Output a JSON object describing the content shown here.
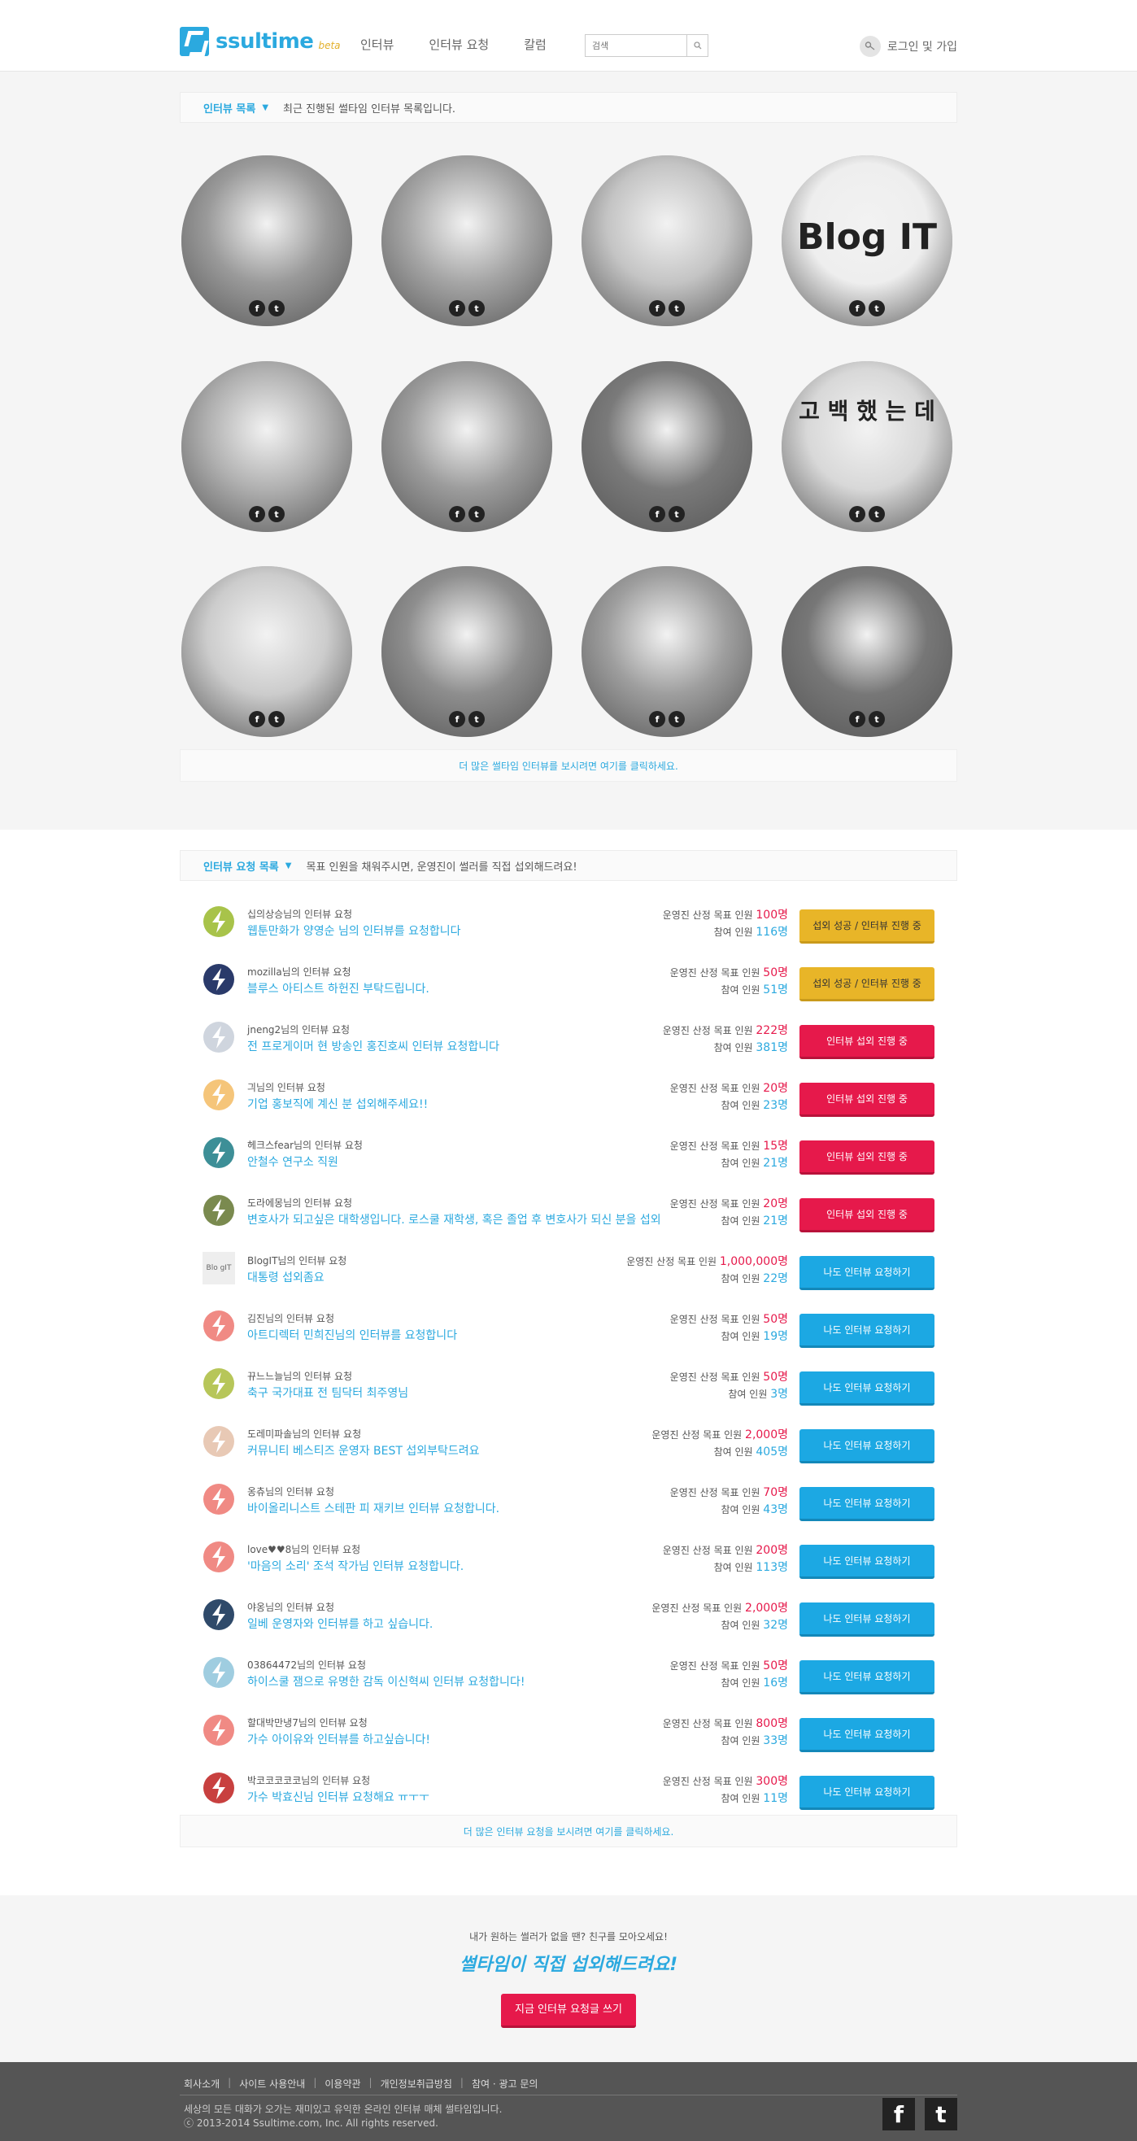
{
  "header": {
    "logo_text": "ssultime",
    "logo_beta": "beta",
    "nav": [
      "인터뷰",
      "인터뷰 요청",
      "칼럼"
    ],
    "search_placeholder": "검색",
    "login": "로그인 및 가입"
  },
  "interviews": {
    "label": "인터뷰 목록",
    "desc": "최근 진행된 썰타임 인터뷰 목록입니다.",
    "more": "더 많은 썰타임 인터뷰를 보시려면 여기를 클릭하세요.",
    "blog_text": "Blog IT",
    "confession_text": "고 백 했 는 데"
  },
  "requests": {
    "label": "인터뷰 요청 목록",
    "desc": "목표 인원을 채워주시면, 운영진이 썰러를 직접 섭외해드려요!",
    "goal_label": "운영진 산정 목표 인원",
    "count_label": "참여 인원",
    "more": "더 많은 인터뷰 요청을 보시려면 여기를 클릭하세요.",
    "rows": [
      {
        "name": "십의상승님의 인터뷰 요청",
        "title": "웹툰만화가 양영순 님의 인터뷰를 요청합니다",
        "goal": "100명",
        "count": "116명",
        "button": "섭외 성공 / 인터뷰 진행 중",
        "btype": "yellow",
        "color": "#a8c34a"
      },
      {
        "name": "mozilla님의 인터뷰 요청",
        "title": "블루스 아티스트 하헌진 부탁드립니다.",
        "goal": "50명",
        "count": "51명",
        "button": "섭외 성공 / 인터뷰 진행 중",
        "btype": "yellow",
        "color": "#2a3a6a"
      },
      {
        "name": "jneng2님의 인터뷰 요청",
        "title": "전 프로게이머 현 방송인 홍진호씨 인터뷰 요청합니다",
        "goal": "222명",
        "count": "381명",
        "button": "인터뷰 섭외 진행 중",
        "btype": "red",
        "color": "#cfd5de"
      },
      {
        "name": "긔님의 인터뷰 요청",
        "title": "기업 홍보직에 계신 분 섭외해주세요!!",
        "goal": "20명",
        "count": "23명",
        "button": "인터뷰 섭외 진행 중",
        "btype": "red",
        "color": "#f5c57a"
      },
      {
        "name": "헤크스fear님의 인터뷰 요청",
        "title": "안철수 연구소 직원",
        "goal": "15명",
        "count": "21명",
        "button": "인터뷰 섭외 진행 중",
        "btype": "red",
        "color": "#3d8f97"
      },
      {
        "name": "도라에몽님의 인터뷰 요청",
        "title": "변호사가 되고싶은 대학생입니다. 로스쿨 재학생, 혹은 졸업 후 변호사가 되신 분을 섭외",
        "goal": "20명",
        "count": "21명",
        "button": "인터뷰 섭외 진행 중",
        "btype": "red",
        "color": "#7a8a4f"
      },
      {
        "name": "BlogIT님의 인터뷰 요청",
        "title": "대통령 섭외좀요",
        "goal": "1,000,000명",
        "count": "22명",
        "button": "나도 인터뷰 요청하기",
        "btype": "blue",
        "color": "#eeeeee",
        "avatar_text": "Blo gIT"
      },
      {
        "name": "김진님의 인터뷰 요청",
        "title": "아트디렉터 민희진님의 인터뷰를 요청합니다",
        "goal": "50명",
        "count": "19명",
        "button": "나도 인터뷰 요청하기",
        "btype": "blue",
        "color": "#f08a84"
      },
      {
        "name": "뀨느느늘님의 인터뷰 요청",
        "title": "축구 국가대표 전 팀닥터 최주영님",
        "goal": "50명",
        "count": "3명",
        "button": "나도 인터뷰 요청하기",
        "btype": "blue",
        "color": "#b7c659"
      },
      {
        "name": "도레미파솔님의 인터뷰 요청",
        "title": "커뮤니티 베스티즈 운영자 BEST 섭외부탁드려요",
        "goal": "2,000명",
        "count": "405명",
        "button": "나도 인터뷰 요청하기",
        "btype": "blue",
        "color": "#e8c9b5"
      },
      {
        "name": "옹츄님의 인터뷰 요청",
        "title": "바이올리니스트 스테판 피 재키브 인터뷰 요청합니다.",
        "goal": "70명",
        "count": "43명",
        "button": "나도 인터뷰 요청하기",
        "btype": "blue",
        "color": "#f08a84"
      },
      {
        "name": "love♥♥8님의 인터뷰 요청",
        "title": "'마음의 소리' 조석 작가님 인터뷰 요청합니다.",
        "goal": "200명",
        "count": "113명",
        "button": "나도 인터뷰 요청하기",
        "btype": "blue",
        "color": "#f08a84"
      },
      {
        "name": "야옹님의 인터뷰 요청",
        "title": "일베 운영자와 인터뷰를 하고 싶습니다.",
        "goal": "2,000명",
        "count": "32명",
        "button": "나도 인터뷰 요청하기",
        "btype": "blue",
        "color": "#2f4a6a"
      },
      {
        "name": "03864472님의 인터뷰 요청",
        "title": "하이스쿨 잼으로 유명한 감독 이신혁씨 인터뷰 요청합니다!",
        "goal": "50명",
        "count": "16명",
        "button": "나도 인터뷰 요청하기",
        "btype": "blue",
        "color": "#9fcde0"
      },
      {
        "name": "할대박만냉7님의 인터뷰 요청",
        "title": "가수 아이유와 인터뷰를 하고싶습니다!",
        "goal": "800명",
        "count": "33명",
        "button": "나도 인터뷰 요청하기",
        "btype": "blue",
        "color": "#f08a84"
      },
      {
        "name": "박코코코코코님의 인터뷰 요청",
        "title": "가수 박효신님 인터뷰 요청해요 ㅠㅜㅜ",
        "goal": "300명",
        "count": "11명",
        "button": "나도 인터뷰 요청하기",
        "btype": "blue",
        "color": "#c8403f"
      }
    ]
  },
  "cta": {
    "line1": "내가 원하는 썰러가 없을 땐? 친구를 모아오세요!",
    "line2": "썰타임이 직접 섭외해드려요!",
    "button": "지금 인터뷰 요청글 쓰기"
  },
  "footer": {
    "links": [
      "회사소개",
      "사이트 사용안내",
      "이용약관",
      "개인정보취급방침",
      "참여 · 광고 문의"
    ],
    "sep": "|",
    "desc1": "세상의 모든 대화가 오가는 재미있고 유익한 온라인 인터뷰 매체 썰타임입니다.",
    "desc2": "ⓒ 2013-2014 Ssultime.com, Inc. All rights reserved.",
    "fb": "f",
    "tw": "t"
  }
}
